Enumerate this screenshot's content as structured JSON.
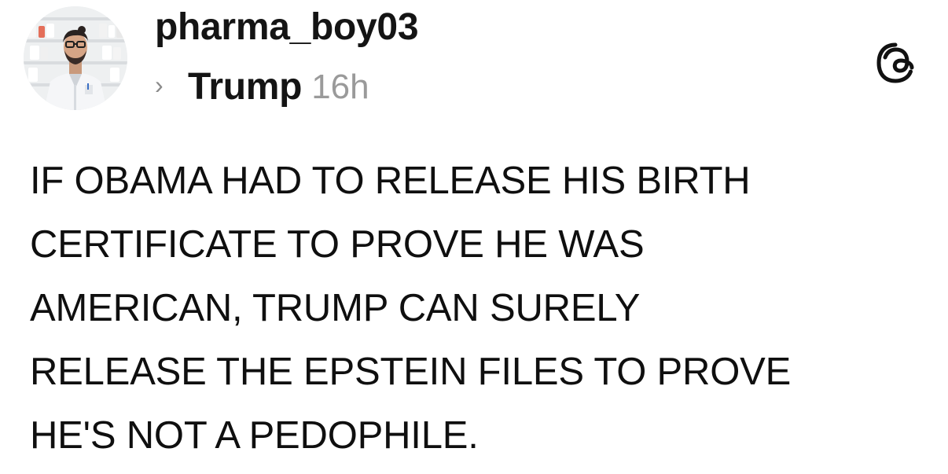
{
  "post": {
    "author": {
      "username": "pharma_boy03",
      "avatar": "avatar-pharmacist-photo"
    },
    "topic": "Trump",
    "timestamp": "16h",
    "topic_separator_icon": "chevron-right-icon",
    "app_icon": "threads-logo-icon",
    "body_lines": [
      "IF OBAMA HAD TO RELEASE HIS BIRTH",
      "CERTIFICATE TO PROVE HE WAS",
      "AMERICAN, TRUMP CAN SURELY",
      "RELEASE THE EPSTEIN FILES TO PROVE",
      "HE'S NOT A PEDOPHILE."
    ]
  },
  "colors": {
    "text_primary": "#111111",
    "text_secondary": "#9a9a9a",
    "background": "#ffffff"
  }
}
